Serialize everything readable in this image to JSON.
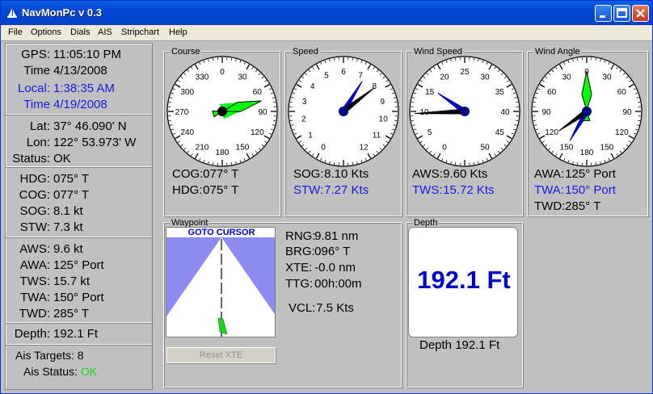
{
  "window": {
    "title": "NavMonPc v 0.3"
  },
  "menu": [
    "File",
    "Options",
    "Dials",
    "AIS",
    "Stripchart",
    "Help"
  ],
  "left": {
    "gps_label": "GPS:",
    "gps": "11:05:10 PM",
    "time_label": "Time",
    "time": "4/13/2008",
    "local_label": "Local:",
    "local": "1:38:35 AM",
    "time2_label": "Time",
    "time2": "4/19/2008",
    "lat_label": "Lat:",
    "lat": "37° 46.090' N",
    "lon_label": "Lon:",
    "lon": "122° 53.973' W",
    "status_label": "Status:",
    "status": "OK",
    "hdg_label": "HDG:",
    "hdg": "075° T",
    "cog_label": "COG:",
    "cog": "077° T",
    "sog_label": "SOG:",
    "sog": "8.1 kt",
    "stw_label": "STW:",
    "stw": "7.3 kt",
    "aws_label": "AWS:",
    "aws": "9.6 kt",
    "awa_label": "AWA:",
    "awa": "125° Port",
    "tws_label": "TWS:",
    "tws": "15.7 kt",
    "twa_label": "TWA:",
    "twa": "150° Port",
    "twd_label": "TWD:",
    "twd": "285° T",
    "depth_label": "Depth:",
    "depth": "192.1 Ft",
    "ais_targets_label": "Ais Targets:",
    "ais_targets": "8",
    "ais_status_label": "Ais Status:",
    "ais_status": "OK"
  },
  "course": {
    "title": "Course",
    "ticks": [
      "0",
      "30",
      "60",
      "90",
      "120",
      "150",
      "180",
      "210",
      "240",
      "270",
      "300",
      "330"
    ],
    "cog_label": "COG:",
    "cog": "077° T",
    "hdg_label": "HDG:",
    "hdg": "075° T",
    "cog_deg": 77,
    "hdg_deg": 75
  },
  "speed": {
    "title": "Speed",
    "ticks": [
      "0",
      "1",
      "2",
      "3",
      "4",
      "5",
      "6",
      "7",
      "8",
      "9",
      "10",
      "11",
      "12"
    ],
    "sog_label": "SOG:",
    "sog": "8.10 Kts",
    "stw_label": "STW:",
    "stw": "7.27 Kts",
    "sog_val": 8.1,
    "stw_val": 7.27
  },
  "windspeed": {
    "title": "Wind Speed",
    "ticks": [
      "0",
      "5",
      "10",
      "15",
      "20",
      "25",
      "30",
      "35",
      "40",
      "45",
      "50"
    ],
    "aws_label": "AWS:",
    "aws": "9.60 Kts",
    "tws_label": "TWS:",
    "tws": "15.72 Kts",
    "aws_val": 9.6,
    "tws_val": 15.72
  },
  "windangle": {
    "title": "Wind Angle",
    "ticks": [
      "0",
      "30",
      "60",
      "90",
      "120",
      "150",
      "180",
      "150",
      "120",
      "90",
      "60",
      "30"
    ],
    "awa_label": "AWA:",
    "awa": "125° Port",
    "twa_label": "TWA:",
    "twa": "150° Port",
    "twd_label": "TWD:",
    "twd": "285° T",
    "awa_deg": -125,
    "twa_deg": -150
  },
  "waypoint": {
    "title": "Waypoint",
    "banner": "GOTO CURSOR",
    "reset": "Reset XTE",
    "rng_label": "RNG:",
    "rng": "9.81 nm",
    "brg_label": "BRG:",
    "brg": "096° T",
    "xte_label": "XTE:",
    "xte": "-0.0 nm",
    "ttg_label": "TTG:",
    "ttg": "00h:00m",
    "vcl_label": "VCL:",
    "vcl": "7.5 Kts"
  },
  "depth": {
    "title": "Depth",
    "big": "192.1 Ft",
    "label": "Depth",
    "value": "192.1 Ft"
  },
  "colors": {
    "title_blue": "#0347d6",
    "needle_green": "#00ff00",
    "needle_blue": "#0000c0",
    "local_blue": "#1a1ae6",
    "ok_green": "#22d022",
    "waypoint_sky": "#8c8cf0"
  }
}
